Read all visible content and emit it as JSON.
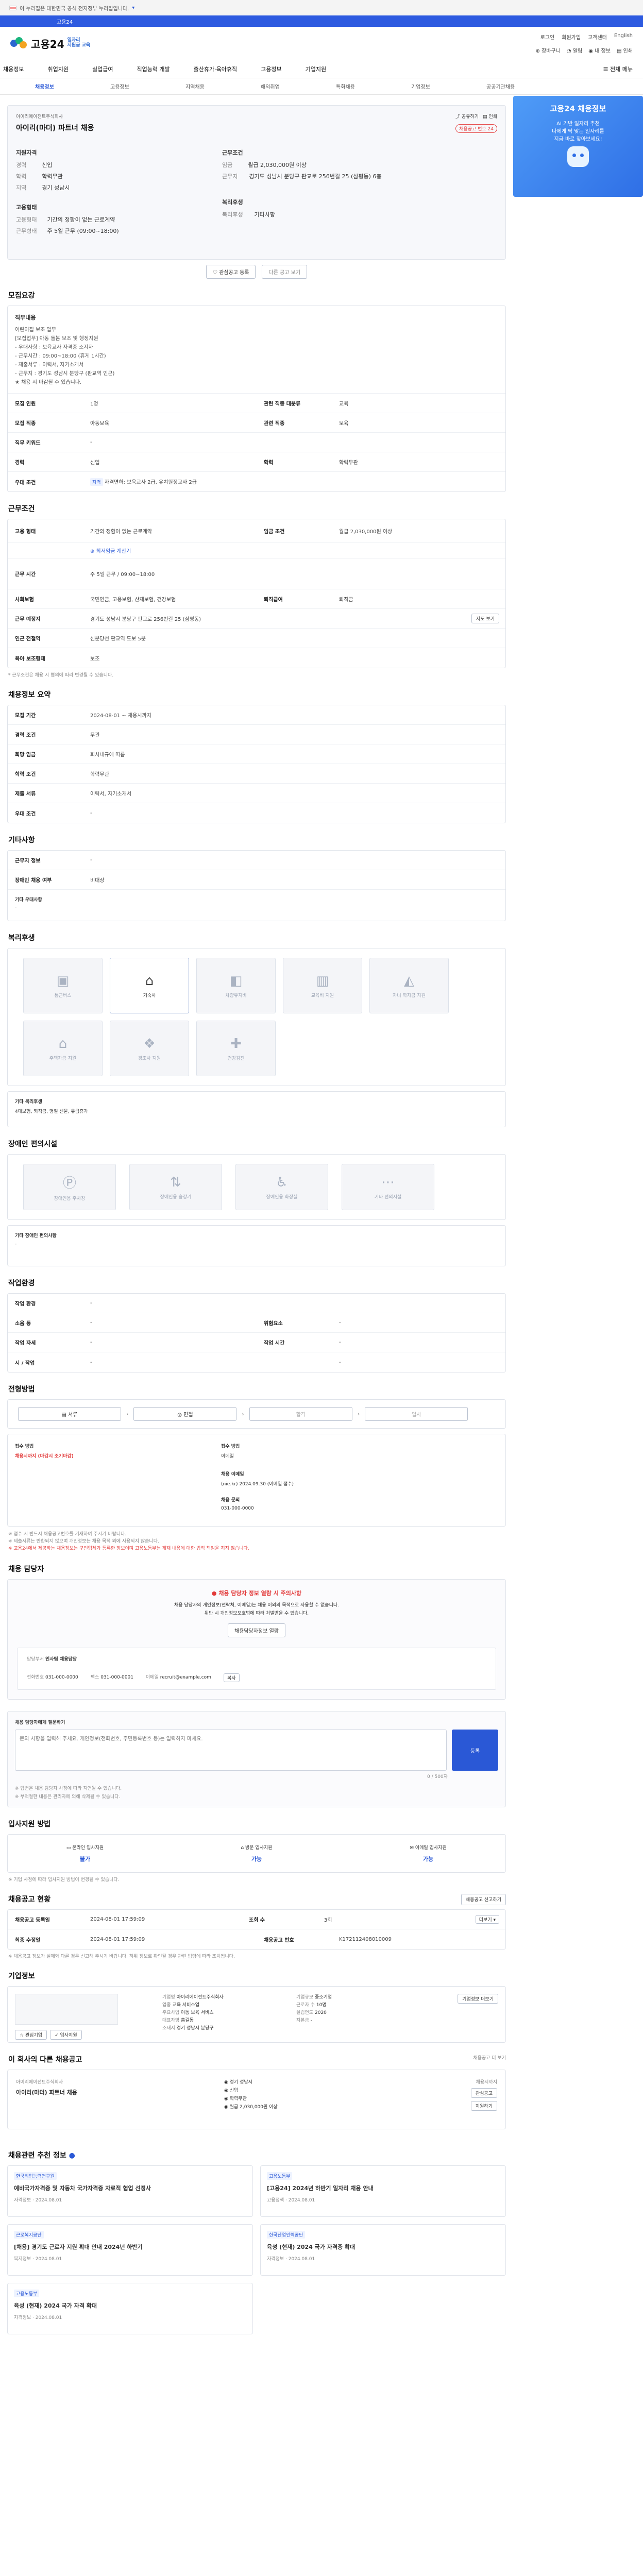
{
  "gov_bar": {
    "text": "이 누리집은 대한민국 공식 전자정부 누리집입니다."
  },
  "top_strip": {
    "text": "고용24"
  },
  "logo": {
    "title": "고용24",
    "sub1": "일자리",
    "sub2": "지원금 교육"
  },
  "header_links": [
    "로그인",
    "회원가입",
    "고객센터",
    "English"
  ],
  "header_links2": [
    "장바구니",
    "알림",
    "내 정보",
    "인쇄"
  ],
  "gnb": [
    "채용정보",
    "취업지원",
    "실업급여",
    "직업능력 개발",
    "출산휴가·육아휴직",
    "고용정보",
    "기업지원",
    "전체 메뉴"
  ],
  "subnav": [
    "채용정보",
    "고용정보",
    "지역채용",
    "해외취업",
    "특화채용",
    "기업정보",
    "공공기관채용"
  ],
  "banner": {
    "title": "고용24 채용정보",
    "line1": "AI 기반 일자리 추천",
    "line2": "나에게 딱 맞는 일자리를",
    "line3": "지금 바로 찾아보세요!"
  },
  "job": {
    "company": "아이리(마더) 파트너 채용",
    "company_small": "아이리에이전트주식회사",
    "title": "아이리(마더) 파트너 채용",
    "badge": "채용공고 번호 24",
    "left_labels": [
      "경력",
      "학력",
      "지역"
    ],
    "left_values": [
      "신입",
      "학력무관",
      "경기 성남시"
    ],
    "right_labels": [
      "임금",
      "근무지"
    ],
    "right_values": [
      "월급 2,030,000원 이상",
      "경기도 성남시 분당구 판교로 256번길 25 (삼평동) 6층"
    ],
    "emp_label": "고용형태",
    "emp_value": "기간의 정함이 없는 근로계약",
    "type_label": "근무형태",
    "type_value": "주 5일 근무 (09:00~18:00)",
    "benefit_label": "복리후생",
    "benefit_value": "기타사항",
    "btn_save": "관심공고 등록",
    "btn_similar": "다른 공고 보기",
    "share": "공유하기",
    "print": "인쇄"
  },
  "recruit": {
    "title": "모집요강",
    "desc_label": "직무내용",
    "desc_lines": [
      "어린이집 보조 업무",
      "[모집업무] 아동 돌봄 보조 및 행정지원",
      "- 우대사항 : 보육교사 자격증 소지자",
      "- 근무시간 : 09:00~18:00 (휴게 1시간)",
      "- 제출서류 : 이력서, 자기소개서",
      "- 근무지 : 경기도 성남시 분당구 (판교역 인근)",
      "★ 채용 시 마감될 수 있습니다."
    ],
    "rows": [
      [
        "모집 인원",
        "1명",
        "관련 직종 대분류",
        "교육"
      ],
      [
        "모집 직종",
        "아동보육",
        "관련 직종",
        "보육"
      ],
      [
        "직무 키워드",
        "-",
        "",
        ""
      ],
      [
        "경력",
        "신입",
        "학력",
        "학력무관"
      ],
      [
        "우대 조건",
        "자격면허: 보육교사 2급, 유치원정교사 2급",
        "",
        ""
      ]
    ]
  },
  "conditions": {
    "title": "근무조건",
    "rows": [
      [
        "고용 형태",
        "기간의 정함이 없는 근로계약",
        "임금 조건",
        "월급 2,030,000원 이상"
      ],
      [
        "",
        "",
        "",
        ""
      ],
      [
        "근무 시간",
        "주 5일 근무 / 09:00~18:00",
        "",
        ""
      ],
      [
        "사회보험",
        "국민연금, 고용보험, 산재보험, 건강보험",
        "퇴직급여",
        "퇴직금"
      ],
      [
        "근무 예정지",
        "경기도 성남시 분당구 판교로 256번길 25 (삼평동)",
        "",
        ""
      ],
      [
        "인근 전철역",
        "신분당선 판교역 도보 5분",
        "",
        ""
      ],
      [
        "육아 보조형태",
        "보조",
        "",
        ""
      ]
    ],
    "note": "* 근무조건은 채용 시 협의에 따라 변경될 수 있습니다."
  },
  "apply": {
    "title": "채용정보 요약",
    "rows": [
      [
        "모집 기간",
        "2024-08-01 ~ 채용시까지"
      ],
      [
        "경력 조건",
        "무관"
      ],
      [
        "희망 임금",
        "회사내규에 따름"
      ],
      [
        "학력 조건",
        "학력무관"
      ],
      [
        "제출 서류",
        "이력서, 자기소개서"
      ],
      [
        "우대 조건",
        "-"
      ]
    ]
  },
  "other": {
    "title": "기타사항",
    "rows": [
      [
        "근무지 정보",
        "-"
      ],
      [
        "장애인 채용 여부",
        "비대상"
      ]
    ],
    "more_label": "기타 우대사항",
    "more_value": "-"
  },
  "benefit": {
    "title": "복리후생",
    "tiles": [
      "통근버스",
      "기숙사",
      "차량유지비",
      "교육비 지원",
      "자녀 학자금 지원",
      "주택자금 지원",
      "경조사 지원",
      "건강검진"
    ],
    "extra_label": "기타 복리후생",
    "extra_value": "4대보험, 퇴직금, 명절 선물, 유급휴가"
  },
  "disability": {
    "title": "장애인 편의시설",
    "tiles": [
      "장애인용 주차장",
      "장애인용 승강기",
      "장애인용 화장실",
      "기타 편의시설"
    ],
    "extra_label": "기타 장애인 편의사항",
    "extra_value": "-"
  },
  "workenv": {
    "title": "작업환경",
    "rows": [
      [
        "작업 환경",
        "-",
        "",
        ""
      ],
      [
        "소음 등",
        "-",
        "위험요소",
        "-"
      ],
      [
        "작업 자세",
        "-",
        "작업 시간",
        "-"
      ],
      [
        "시 / 작업",
        "-",
        "",
        "-"
      ]
    ]
  },
  "process": {
    "title": "전형방법",
    "steps": [
      "서류",
      "면접",
      "합격",
      "입사"
    ],
    "left_label": "접수 방법",
    "left_value": "채용시까지 (마감시 조기마감)",
    "right_label": "접수 방법",
    "right_value": "이메일",
    "email_label": "채용 이메일",
    "email_value": "(nie.kr) 2024.09.30 (이메일 접수)",
    "contact_label": "채용 문의",
    "contact_value": "031-000-0000",
    "notice_lines": [
      "※ 접수 시 반드시 채용공고번호를 기재하여 주시기 바랍니다.",
      "※ 제출서류는 반환되지 않으며 개인정보는 채용 목적 외에 사용되지 않습니다.",
      "※ 고용24에서 제공하는 채용정보는 구인업체가 등록한 정보이며 고용노동부는 게재 내용에 대한 법적 책임을 지지 않습니다."
    ]
  },
  "manager": {
    "title": "채용 담당자",
    "warn_title": "채용 담당자 정보 열람 시 주의사항",
    "warn_line1": "채용 담당자의 개인정보(연락처, 이메일)는 채용 이외의 목적으로 사용할 수 없습니다.",
    "warn_line2": "위반 시 개인정보보호법에 따라 처벌받을 수 있습니다.",
    "btn": "채용담당자정보 열람",
    "dept_label": "담당부서",
    "dept_value": "인사팀 채용담당",
    "phone_label": "전화번호",
    "phone_value": "031-000-0000",
    "fax_label": "팩스",
    "fax_value": "031-000-0001",
    "email_label": "이메일",
    "email_value": "recruit@example.com"
  },
  "inquiry": {
    "title": "채용 담당자에게 질문하기",
    "placeholder": "문의 사항을 입력해 주세요. 개인정보(전화번호, 주민등록번호 등)는 입력하지 마세요.",
    "count": "0 / 500자",
    "submit": "등록",
    "notes": [
      "※ 답변은 채용 담당자 사정에 따라 지연될 수 있습니다.",
      "※ 부적절한 내용은 관리자에 의해 삭제될 수 있습니다."
    ]
  },
  "steps_info": {
    "title": "입사지원 방법",
    "items": [
      {
        "label": "온라인 입사지원",
        "value": "불가"
      },
      {
        "label": "방문 입사지원",
        "value": "가능"
      },
      {
        "label": "이메일 입사지원",
        "value": "가능"
      }
    ],
    "note": "※ 기업 사정에 따라 입사지원 방법이 변경될 수 있습니다."
  },
  "status": {
    "title": "채용공고 현황",
    "link": "채용공고 신고하기",
    "rows": [
      [
        "채용공고 등록일",
        "2024-08-01 17:59:09",
        "조회 수",
        "3회"
      ],
      [
        "최종 수정일",
        "2024-08-01 17:59:09",
        "채용공고 번호",
        "K172112408010009"
      ]
    ],
    "note": "※ 채용공고 정보가 실제와 다른 경우 신고해 주시기 바랍니다. 허위 정보로 확인될 경우 관련 법령에 따라 조치됩니다.",
    "btn_share": "공유하기",
    "btn_scrap": "스크랩"
  },
  "company": {
    "title": "기업정보",
    "labels": [
      "기업명",
      "업종",
      "주요사업",
      "대표자명",
      "소재지"
    ],
    "values": [
      "아이리에이전트주식회사",
      "교육 서비스업",
      "아동 보육 서비스",
      "홍길동",
      "경기 성남시 분당구"
    ],
    "right_labels": [
      "기업규모",
      "근로자 수",
      "설립연도",
      "자본금"
    ],
    "right_values": [
      "중소기업",
      "10명",
      "2020",
      "-"
    ],
    "btn": "기업정보 더보기",
    "btn_fav": "관심기업",
    "btn_apply": "입사지원"
  },
  "similar": {
    "title": "이 회사의 다른 채용공고",
    "link": "채용공고 더 보기",
    "company": "아이리에이전트주식회사",
    "job": "아이리(마더) 파트너 채용",
    "info": [
      "경기 성남시",
      "신입",
      "학력무관",
      "월급 2,030,000원 이상"
    ],
    "deadline": "채용시까지",
    "btn1": "관심공고",
    "btn2": "지원하기"
  },
  "recommend": {
    "title": "채용관련 추천 정보",
    "items": [
      {
        "org": "한국직업능력연구원",
        "title": "예비국가자격증 및 자동차 국가자격증 자료적 협업 선정사",
        "sub": "자격정보",
        "date": "2024.08.01"
      },
      {
        "org": "고용노동부",
        "title": "[고용24] 2024년 하반기 일자리 채용 안내",
        "sub": "고용정책",
        "date": "2024.08.01"
      },
      {
        "org": "근로복지공단",
        "title": "[채용] 경기도 근로자 지원 확대 안내 2024년 하반기",
        "sub": "복지정보",
        "date": "2024.08.01"
      },
      {
        "org": "한국산업인력공단",
        "title": "육성 (현재) 2024 국가 자격증 확대",
        "sub": "자격정보",
        "date": "2024.08.01"
      },
      {
        "org": "고용노동부",
        "title": "육성 (현재) 2024 국가 자격 확대",
        "sub": "자격정보",
        "date": "2024.08.01"
      }
    ]
  }
}
